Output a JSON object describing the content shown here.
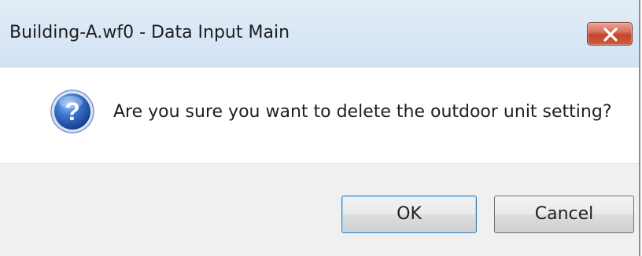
{
  "window": {
    "title": "Building-A.wf0 - Data Input Main",
    "close_icon": "close-icon"
  },
  "dialog": {
    "icon": "question-icon",
    "message": "Are you sure you want to delete the outdoor unit setting?"
  },
  "buttons": {
    "ok_label": "OK",
    "cancel_label": "Cancel"
  },
  "colors": {
    "titlebar": "#dae7f5",
    "close_button": "#c5452c",
    "footer": "#f0f0f0",
    "icon_blue": "#2a5fb8"
  }
}
